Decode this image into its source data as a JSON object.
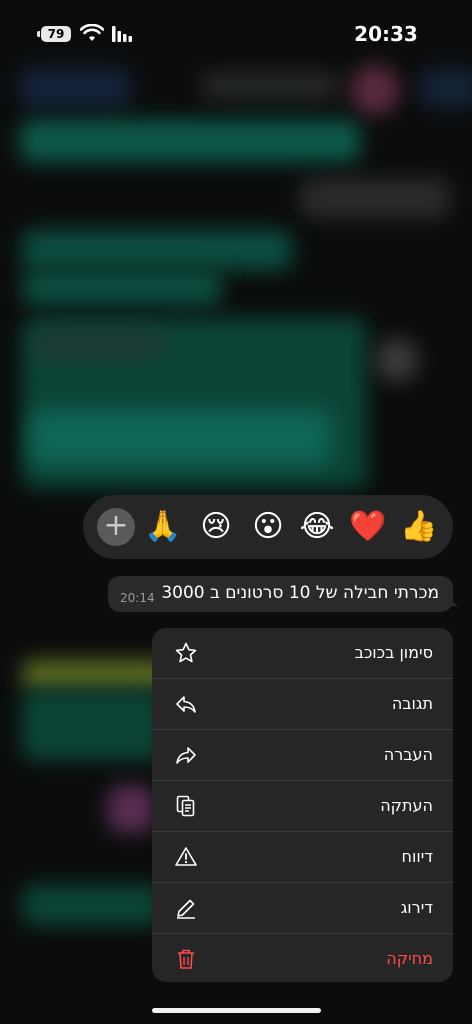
{
  "status_bar": {
    "battery": "79",
    "time": "20:33"
  },
  "reactions": {
    "add_label": "+",
    "emojis": [
      "👍",
      "❤️",
      "😂",
      "😮",
      "😢",
      "🙏"
    ]
  },
  "message": {
    "text": "מכרתי חבילה של 10 סרטונים ב 3000",
    "time": "20:14"
  },
  "menu": {
    "items": [
      {
        "label": "סימון בכוכב",
        "icon": "star-icon"
      },
      {
        "label": "תגובה",
        "icon": "reply-icon"
      },
      {
        "label": "העברה",
        "icon": "forward-icon"
      },
      {
        "label": "העתקה",
        "icon": "copy-icon"
      },
      {
        "label": "דיווח",
        "icon": "warning-icon"
      },
      {
        "label": "דירוג",
        "icon": "pencil-icon"
      },
      {
        "label": "מחיקה",
        "icon": "trash-icon"
      }
    ]
  },
  "colors": {
    "danger": "#ff4a4a",
    "menu_bg": "#262626"
  }
}
